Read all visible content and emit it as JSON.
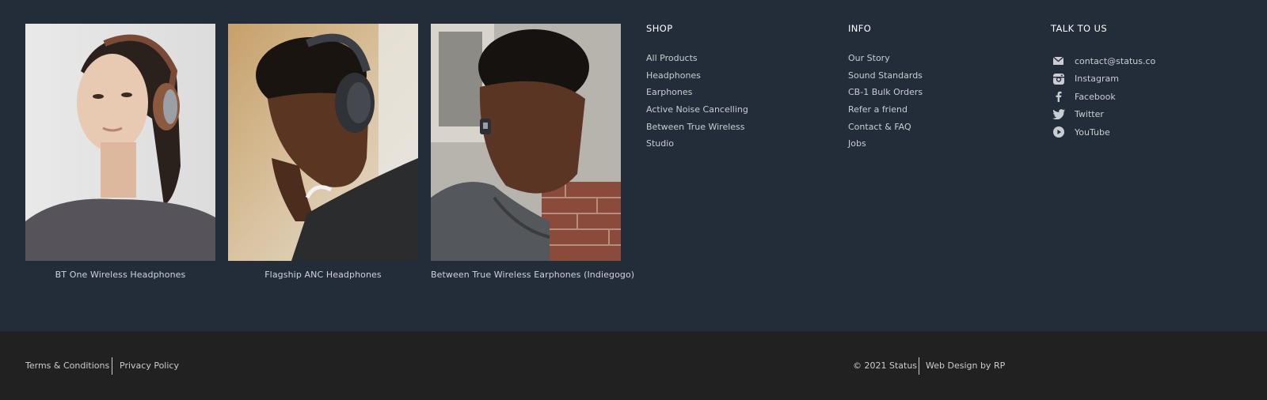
{
  "products": [
    {
      "caption": "BT One Wireless Headphones",
      "image": "woman-wearing-wood-and-chrome-on-ear-headphones"
    },
    {
      "caption": "Flagship ANC Headphones",
      "image": "man-smiling-wearing-black-over-ear-headphones"
    },
    {
      "caption": "Between True Wireless Earphones (Indiegogo)",
      "image": "man-wearing-true-wireless-earbud"
    }
  ],
  "shop": {
    "title": "SHOP",
    "links": [
      "All Products",
      "Headphones",
      "Earphones",
      "Active Noise Cancelling",
      "Between True Wireless",
      "Studio"
    ]
  },
  "info": {
    "title": "INFO",
    "links": [
      "Our Story",
      "Sound Standards",
      "CB-1 Bulk Orders",
      "Refer a friend",
      "Contact & FAQ",
      "Jobs"
    ]
  },
  "talk": {
    "title": "TALK TO US",
    "items": [
      {
        "label": "contact@status.co",
        "icon": "mail-icon"
      },
      {
        "label": "Instagram",
        "icon": "instagram-icon"
      },
      {
        "label": "Facebook",
        "icon": "facebook-icon"
      },
      {
        "label": "Twitter",
        "icon": "twitter-icon"
      },
      {
        "label": "YouTube",
        "icon": "youtube-icon"
      }
    ]
  },
  "bottom": {
    "terms": "Terms & Conditions",
    "privacy": "Privacy Policy",
    "copyright": "© 2021 Status",
    "credit": "Web Design by RP"
  },
  "colors": {
    "footer_bg": "#232d39",
    "bottom_bar_bg": "#212121",
    "heading": "#ffffff",
    "link": "#c9cdd2"
  }
}
